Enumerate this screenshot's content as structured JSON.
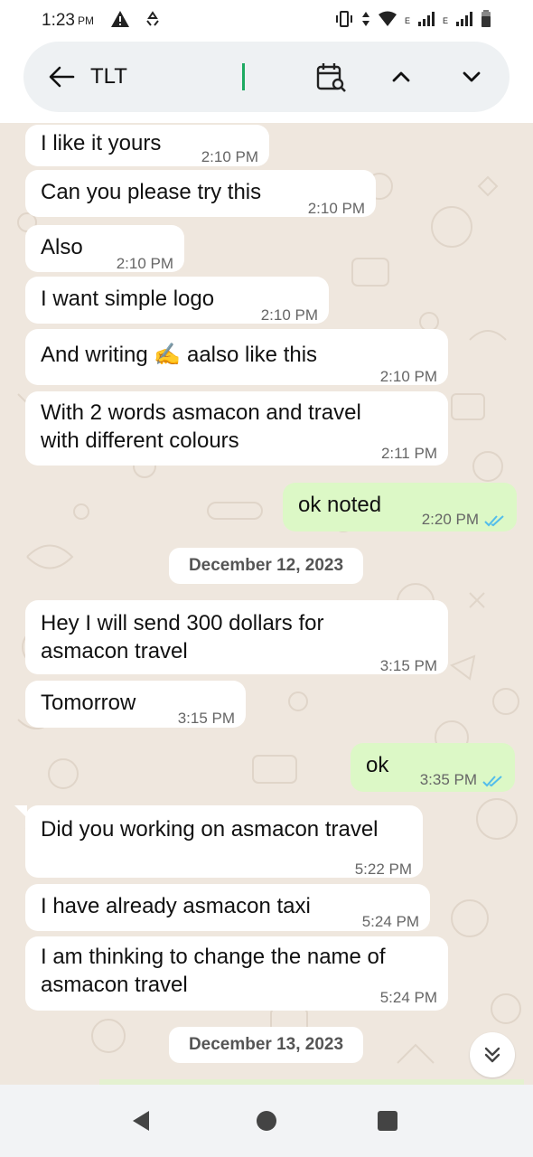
{
  "status_bar": {
    "time": "1:23",
    "ampm": "PM",
    "network_badge_1": "E",
    "network_badge_2": "E"
  },
  "search": {
    "query": "TLT",
    "icons": [
      "arrow-left-icon",
      "calendar-search-icon",
      "chevron-up-icon",
      "chevron-down-icon"
    ]
  },
  "messages": [
    {
      "dir": "in",
      "text": "I like it yours",
      "time": "2:10 PM"
    },
    {
      "dir": "in",
      "text": "Can you please try this",
      "time": "2:10 PM"
    },
    {
      "dir": "in",
      "text": "Also",
      "time": "2:10 PM"
    },
    {
      "dir": "in",
      "text": "I want simple logo",
      "time": "2:10 PM"
    },
    {
      "dir": "in",
      "text_before": "And writing",
      "emoji": "✍️",
      "text_after": "aalso like this",
      "time": "2:10 PM"
    },
    {
      "dir": "in",
      "line1": "With 2 words asmacon and travel",
      "line2": "with different colours",
      "time": "2:11 PM"
    },
    {
      "dir": "out",
      "text": "ok noted",
      "time": "2:20 PM",
      "status": "read"
    },
    {
      "dir": "date",
      "text": "December 12, 2023"
    },
    {
      "dir": "in",
      "line1": "Hey I will send 300 dollars for",
      "line2": "asmacon travel",
      "time": "3:15 PM"
    },
    {
      "dir": "in",
      "text": "Tomorrow",
      "time": "3:15 PM"
    },
    {
      "dir": "out",
      "text": "ok",
      "time": "3:35 PM",
      "status": "read"
    },
    {
      "dir": "in",
      "text": "Did you working on asmacon travel",
      "time": "5:22 PM"
    },
    {
      "dir": "in",
      "text": "I have already asmacon taxi",
      "time": "5:24 PM"
    },
    {
      "dir": "in",
      "line1": "I am thinking to change the name of",
      "line2": "asmacon travel",
      "time": "5:24 PM"
    },
    {
      "dir": "date",
      "text": "December 13, 2023"
    }
  ],
  "colors": {
    "chat_bg": "#efe7de",
    "incoming": "#ffffff",
    "outgoing": "#dcf8c6",
    "read_ticks": "#53bdeb",
    "cursor": "#1daa61"
  },
  "nav_bar": {
    "buttons": [
      "back-triangle-icon",
      "home-circle-icon",
      "recents-square-icon"
    ]
  }
}
